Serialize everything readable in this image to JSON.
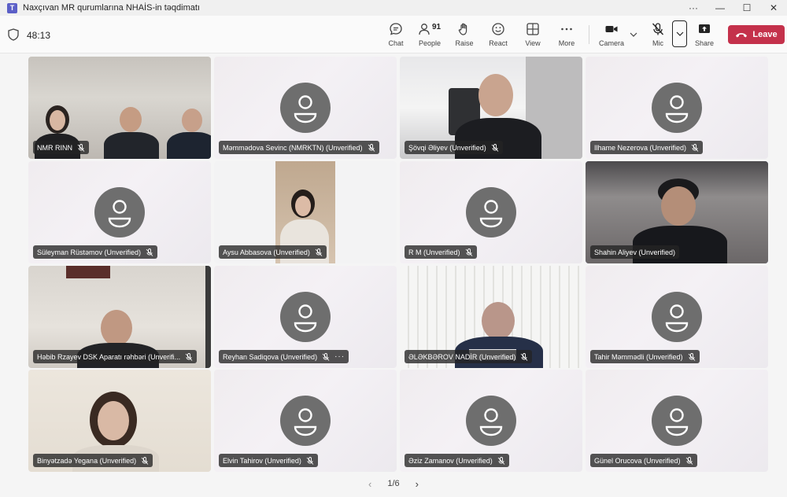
{
  "window": {
    "title": "Naxçıvan MR qurumlarına NHAİS-in təqdimatı",
    "controls": [
      "···",
      "—",
      "☐",
      "✕"
    ]
  },
  "toolbar": {
    "timer": "48:13",
    "chat_label": "Chat",
    "people_label": "People",
    "people_count": "91",
    "raise_label": "Raise",
    "react_label": "React",
    "view_label": "View",
    "more_label": "More",
    "camera_label": "Camera",
    "mic_label": "Mic",
    "share_label": "Share",
    "leave_label": "Leave"
  },
  "participants": [
    {
      "name": "NMR RINN",
      "video": true
    },
    {
      "name": "Məmmədova Sevinc (NMRKTN) (Unverified)",
      "video": false
    },
    {
      "name": "Şövqi Əliyev (Unverified)",
      "video": true
    },
    {
      "name": "Ilhame Nezerova (Unverified)",
      "video": false
    },
    {
      "name": "Süleyman Rüstəmov (Unverified)",
      "video": false
    },
    {
      "name": "Aysu Abbasova (Unverified)",
      "video": true
    },
    {
      "name": "R M (Unverified)",
      "video": false
    },
    {
      "name": "Shahin Aliyev (Unverified)",
      "video": true,
      "speaking": true
    },
    {
      "name": "Həbib Rzayev DSK Aparatı rəhbəri (Unverifi...",
      "video": true
    },
    {
      "name": "Reyhan Sadiqova (Unverified)",
      "video": false,
      "more": "···"
    },
    {
      "name": "ƏLƏKBƏROV NADİR (Unverified)",
      "video": true
    },
    {
      "name": "Tahir Məmmədli (Unverified)",
      "video": false
    },
    {
      "name": "Binyətzadə Yegana (Unverified)",
      "video": true
    },
    {
      "name": "Elvin Tahirov (Unverified)",
      "video": false
    },
    {
      "name": "Əziz Zamanov (Unverified)",
      "video": false
    },
    {
      "name": "Günel Orucova (Unverified)",
      "video": false
    }
  ],
  "pager": {
    "prev": "‹",
    "label": "1/6",
    "next": "›"
  },
  "colors": {
    "leave": "#c4314b",
    "speaking_outline": "#6264a7",
    "avatar": "#6e6e6e"
  }
}
